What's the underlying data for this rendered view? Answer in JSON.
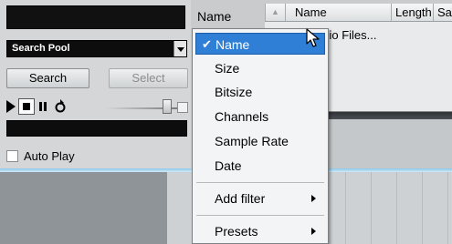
{
  "left_panel": {
    "pool_select": {
      "value": "Search Pool"
    },
    "search_button": "Search",
    "select_button": "Select",
    "auto_play_label": "Auto Play",
    "auto_play_checked": false
  },
  "sort_label": "Name",
  "list": {
    "columns": [
      "Name",
      "Length",
      "Sa"
    ],
    "rows": [
      "udio Files..."
    ]
  },
  "menu": {
    "items": [
      {
        "label": "Name",
        "checked": true,
        "selected": true
      },
      {
        "label": "Size"
      },
      {
        "label": "Bitsize"
      },
      {
        "label": "Channels"
      },
      {
        "label": "Sample Rate"
      },
      {
        "label": "Date"
      }
    ],
    "add_filter": "Add filter",
    "presets": "Presets"
  },
  "colors": {
    "menu_highlight": "#2f7fd6",
    "dark_field": "#0d0d0d",
    "divider": "#8ec8ea"
  }
}
